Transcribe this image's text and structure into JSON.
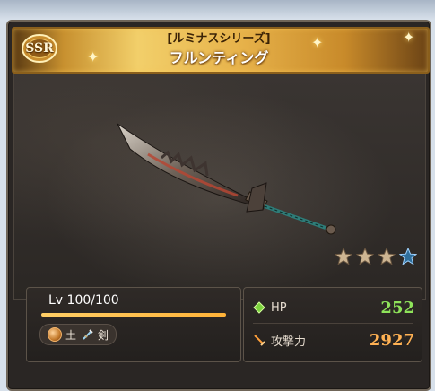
{
  "card": {
    "rarity": "SSR",
    "series": "[ルミナスシリーズ]",
    "name": "フルンティング",
    "stars": {
      "filled": 3,
      "total": 4
    }
  },
  "level": {
    "label": "Lv 100/100",
    "progress": 1.0
  },
  "tags": {
    "element_icon": "earth-element-icon",
    "element": "土",
    "type_icon": "sword-icon",
    "type": "剣"
  },
  "stats": {
    "hp_label": "HP",
    "hp_value": "252",
    "atk_label": "攻撃力",
    "atk_value": "2927"
  },
  "colors": {
    "hp": "#8ee35a",
    "atk": "#ffb153",
    "gold": "#e7b24a"
  }
}
